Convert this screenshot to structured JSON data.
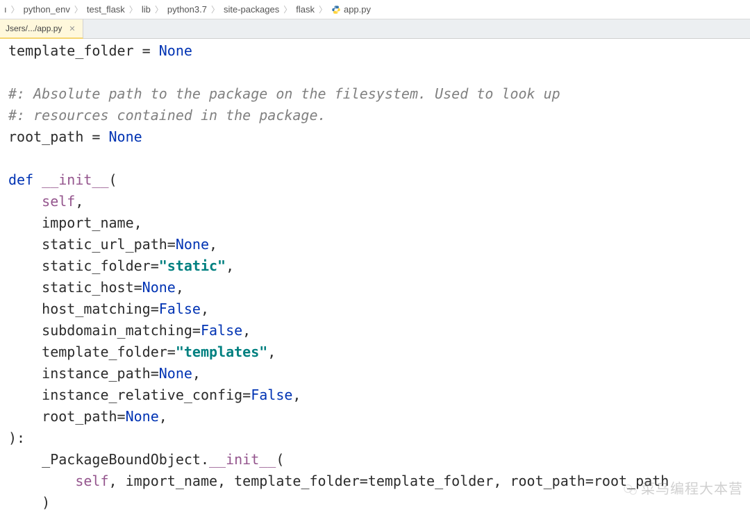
{
  "breadcrumbs": {
    "items": [
      {
        "label": "ı"
      },
      {
        "label": "python_env"
      },
      {
        "label": "test_flask"
      },
      {
        "label": "lib"
      },
      {
        "label": "python3.7"
      },
      {
        "label": "site-packages"
      },
      {
        "label": "flask"
      },
      {
        "label": "app.py",
        "icon": "python"
      }
    ]
  },
  "tabs": {
    "active": {
      "label": "Jsers/.../app.py"
    }
  },
  "code": {
    "lines": [
      {
        "indent": "",
        "segs": [
          {
            "t": "template_folder = ",
            "c": ""
          },
          {
            "t": "None",
            "c": "kw"
          }
        ]
      },
      {
        "indent": "",
        "segs": []
      },
      {
        "indent": "",
        "segs": [
          {
            "t": "#: Absolute path to the package on the filesystem. Used to look up",
            "c": "cmt"
          }
        ]
      },
      {
        "indent": "",
        "segs": [
          {
            "t": "#: resources contained in the package.",
            "c": "cmt"
          }
        ]
      },
      {
        "indent": "",
        "segs": [
          {
            "t": "root_path = ",
            "c": ""
          },
          {
            "t": "None",
            "c": "kw"
          }
        ]
      },
      {
        "indent": "",
        "segs": []
      },
      {
        "indent": "",
        "segs": [
          {
            "t": "def",
            "c": "kw"
          },
          {
            "t": " ",
            "c": ""
          },
          {
            "t": "__init__",
            "c": "fn-magic"
          },
          {
            "t": "(",
            "c": ""
          }
        ]
      },
      {
        "indent": "    ",
        "segs": [
          {
            "t": "self",
            "c": "self"
          },
          {
            "t": ",",
            "c": ""
          }
        ]
      },
      {
        "indent": "    ",
        "segs": [
          {
            "t": "import_name,",
            "c": ""
          }
        ]
      },
      {
        "indent": "    ",
        "segs": [
          {
            "t": "static_url_path=",
            "c": ""
          },
          {
            "t": "None",
            "c": "kw"
          },
          {
            "t": ",",
            "c": ""
          }
        ]
      },
      {
        "indent": "    ",
        "segs": [
          {
            "t": "static_folder=",
            "c": ""
          },
          {
            "t": "\"static\"",
            "c": "str"
          },
          {
            "t": ",",
            "c": ""
          }
        ]
      },
      {
        "indent": "    ",
        "segs": [
          {
            "t": "static_host=",
            "c": ""
          },
          {
            "t": "None",
            "c": "kw"
          },
          {
            "t": ",",
            "c": ""
          }
        ]
      },
      {
        "indent": "    ",
        "segs": [
          {
            "t": "host_matching=",
            "c": ""
          },
          {
            "t": "False",
            "c": "kw"
          },
          {
            "t": ",",
            "c": ""
          }
        ]
      },
      {
        "indent": "    ",
        "segs": [
          {
            "t": "subdomain_matching=",
            "c": ""
          },
          {
            "t": "False",
            "c": "kw"
          },
          {
            "t": ",",
            "c": ""
          }
        ]
      },
      {
        "indent": "    ",
        "segs": [
          {
            "t": "template_folder=",
            "c": ""
          },
          {
            "t": "\"templates\"",
            "c": "str"
          },
          {
            "t": ",",
            "c": ""
          }
        ]
      },
      {
        "indent": "    ",
        "segs": [
          {
            "t": "instance_path=",
            "c": ""
          },
          {
            "t": "None",
            "c": "kw"
          },
          {
            "t": ",",
            "c": ""
          }
        ]
      },
      {
        "indent": "    ",
        "segs": [
          {
            "t": "instance_relative_config=",
            "c": ""
          },
          {
            "t": "False",
            "c": "kw"
          },
          {
            "t": ",",
            "c": ""
          }
        ]
      },
      {
        "indent": "    ",
        "segs": [
          {
            "t": "root_path=",
            "c": ""
          },
          {
            "t": "None",
            "c": "kw"
          },
          {
            "t": ",",
            "c": ""
          }
        ]
      },
      {
        "indent": "",
        "segs": [
          {
            "t": "):",
            "c": ""
          }
        ]
      },
      {
        "indent": "    ",
        "segs": [
          {
            "t": "_PackageBoundObject.",
            "c": ""
          },
          {
            "t": "__init__",
            "c": "fn-magic"
          },
          {
            "t": "(",
            "c": ""
          }
        ]
      },
      {
        "indent": "        ",
        "segs": [
          {
            "t": "self",
            "c": "self"
          },
          {
            "t": ", import_name, template_folder=template_folder, ",
            "c": ""
          },
          {
            "t": "root_path=root_path",
            "c": ""
          }
        ]
      },
      {
        "indent": "    ",
        "segs": [
          {
            "t": ")",
            "c": ""
          }
        ]
      }
    ]
  },
  "watermark": {
    "text": "菜鸟编程大本营"
  }
}
